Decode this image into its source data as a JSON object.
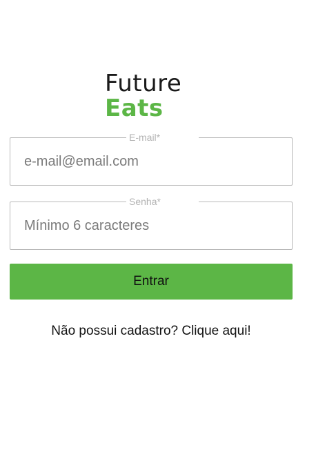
{
  "logo": {
    "line1": "Future",
    "line2": "Eats",
    "colors": {
      "line1": "#1a1a1a",
      "line2": "#5cb646"
    }
  },
  "form": {
    "email": {
      "label": "E-mail*",
      "value": "",
      "placeholder": "e-mail@email.com"
    },
    "password": {
      "label": "Senha*",
      "value": "",
      "placeholder": "Mínimo 6 caracteres"
    },
    "submit_label": "Entrar",
    "accent_color": "#5cb646"
  },
  "signup_link": "Não possui cadastro? Clique aqui!"
}
